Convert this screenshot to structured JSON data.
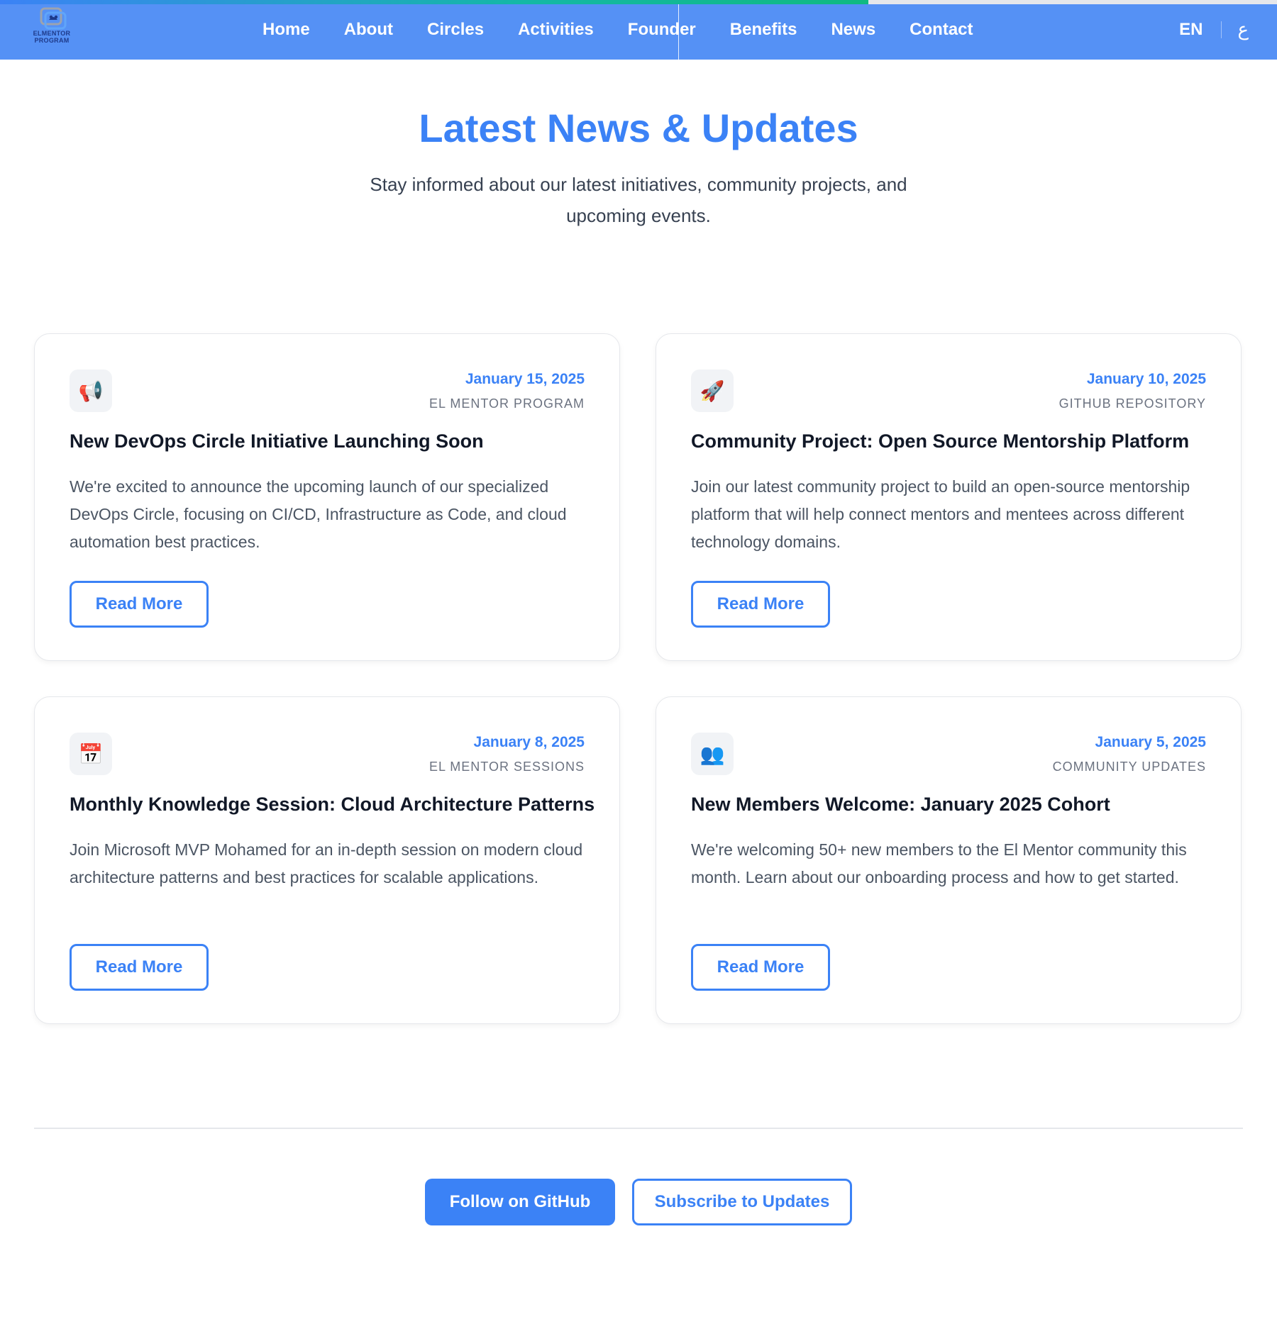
{
  "scroll_progress_percent": 68,
  "logo": {
    "text_line1": "ELMENTOR",
    "text_line2": "PROGRAM",
    "icon": "mentor-logo-icon"
  },
  "nav": {
    "links": [
      "Home",
      "About",
      "Circles",
      "Activities",
      "Founder",
      "Benefits",
      "News",
      "Contact"
    ],
    "lang_en": "EN",
    "lang_ar": "ع"
  },
  "hero": {
    "title": "Latest News & Updates",
    "subtitle": "Stay informed about our latest initiatives, community projects, and upcoming events."
  },
  "news": [
    {
      "icon": "megaphone-icon",
      "icon_glyph": "📢",
      "date": "January 15, 2025",
      "source": "EL MENTOR PROGRAM",
      "title": "New DevOps Circle Initiative Launching Soon",
      "text": "We're excited to announce the upcoming launch of our specialized DevOps Circle, focusing on CI/CD, Infrastructure as Code, and cloud automation best practices.",
      "button": "Read More"
    },
    {
      "icon": "rocket-icon",
      "icon_glyph": "🚀",
      "date": "January 10, 2025",
      "source": "GITHUB REPOSITORY",
      "title": "Community Project: Open Source Mentorship Platform",
      "text": "Join our latest community project to build an open-source mentorship platform that will help connect mentors and mentees across different technology domains.",
      "button": "Read More"
    },
    {
      "icon": "calendar-icon",
      "icon_glyph": "📅",
      "date": "January 8, 2025",
      "source": "EL MENTOR SESSIONS",
      "title": "Monthly Knowledge Session: Cloud Architecture Patterns",
      "text": "Join Microsoft MVP Mohamed for an in-depth session on modern cloud architecture patterns and best practices for scalable applications.",
      "button": "Read More"
    },
    {
      "icon": "people-icon",
      "icon_glyph": "👥",
      "date": "January 5, 2025",
      "source": "COMMUNITY UPDATES",
      "title": "New Members Welcome: January 2025 Cohort",
      "text": "We're welcoming 50+ new members to the El Mentor community this month. Learn about our onboarding process and how to get started.",
      "button": "Read More"
    }
  ],
  "actions": {
    "github": "Follow on GitHub",
    "subscribe": "Subscribe to Updates"
  },
  "colors": {
    "nav_bg": "#5591f5",
    "accent": "#3b82f6",
    "progress_start": "#3b82f6",
    "progress_end": "#10b981"
  }
}
